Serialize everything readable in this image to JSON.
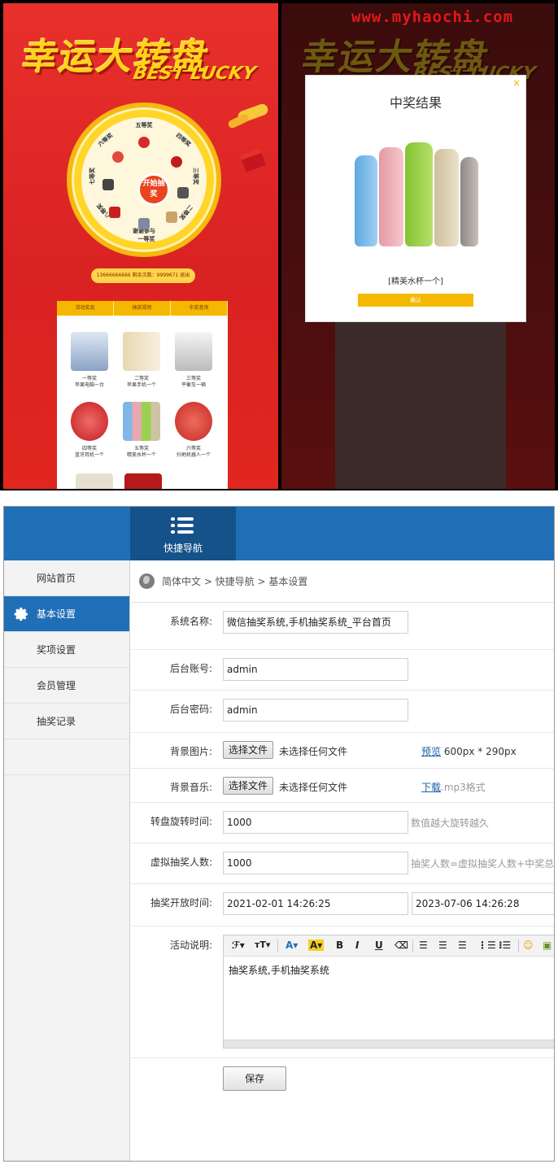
{
  "promo": {
    "brand_title": "幸运大转盘",
    "brand_sub": "BEST LUCKY",
    "wheel_button": "开始抽奖",
    "wheel_segments": [
      "五等奖",
      "四等奖",
      "三等奖",
      "二等奖",
      "谢谢参与",
      "一等奖",
      "八等奖",
      "七等奖",
      "六等奖"
    ],
    "phone_bar": "13666666666 剩余次数：9999671 退出",
    "tabs": [
      "活动奖品",
      "抽奖规则",
      "中奖查询"
    ],
    "prizes": [
      {
        "rank": "一等奖",
        "name": "苹果电脑一台",
        "color": "#b9c8dc"
      },
      {
        "rank": "二等奖",
        "name": "苹果手机一个",
        "color": "#e8d7b0"
      },
      {
        "rank": "三等奖",
        "name": "平衡车一辆",
        "color": "#cfcfcf"
      },
      {
        "rank": "四等奖",
        "name": "蓝牙耳机一个",
        "color": "#d62b2b"
      },
      {
        "rank": "五等奖",
        "name": "精美水杯一个",
        "color": "#9fc7e8"
      },
      {
        "rank": "六等奖",
        "name": "扫地机器人一个",
        "color": "#e04a3d"
      }
    ],
    "watermark": "www.myhaochi.com",
    "overlay": {
      "title": "中奖结果",
      "close": "×",
      "prize_name": "[精美水杯一个]",
      "confirm": "确认"
    }
  },
  "admin": {
    "quick_nav": "快捷导航",
    "sidebar": [
      "网站首页",
      "基本设置",
      "奖项设置",
      "会员管理",
      "抽奖记录"
    ],
    "breadcrumb": "简体中文 > 快捷导航 > 基本设置",
    "form": {
      "site_name_label": "系统名称:",
      "site_name_value": "微信抽奖系统,手机抽奖系统_平台首页",
      "account_label": "后台账号:",
      "account_value": "admin",
      "password_label": "后台密码:",
      "password_value": "admin",
      "bg_image_label": "背景图片:",
      "choose_file": "选择文件",
      "no_file": "未选择任何文件",
      "preview_link": "预览",
      "preview_size": "600px * 290px",
      "bg_music_label": "背景音乐:",
      "download_link": "下载",
      "music_format": ".mp3格式",
      "spin_time_label": "转盘旋转时间:",
      "spin_time_value": "1000",
      "spin_time_hint": "数值越大旋转越久",
      "virtual_label": "虚拟抽奖人数:",
      "virtual_value": "1000",
      "virtual_hint": "抽奖人数=虚拟抽奖人数+中奖总计",
      "open_time_label": "抽奖开放时间:",
      "open_time_start": "2021-02-01 14:26:25",
      "open_time_end": "2023-07-06 14:26:28",
      "desc_label": "活动说明:",
      "desc_value": "抽奖系统,手机抽奖系统",
      "save": "保存"
    },
    "colors": {
      "topbar": "#1f6fb7",
      "accent": "#f5b800"
    }
  }
}
